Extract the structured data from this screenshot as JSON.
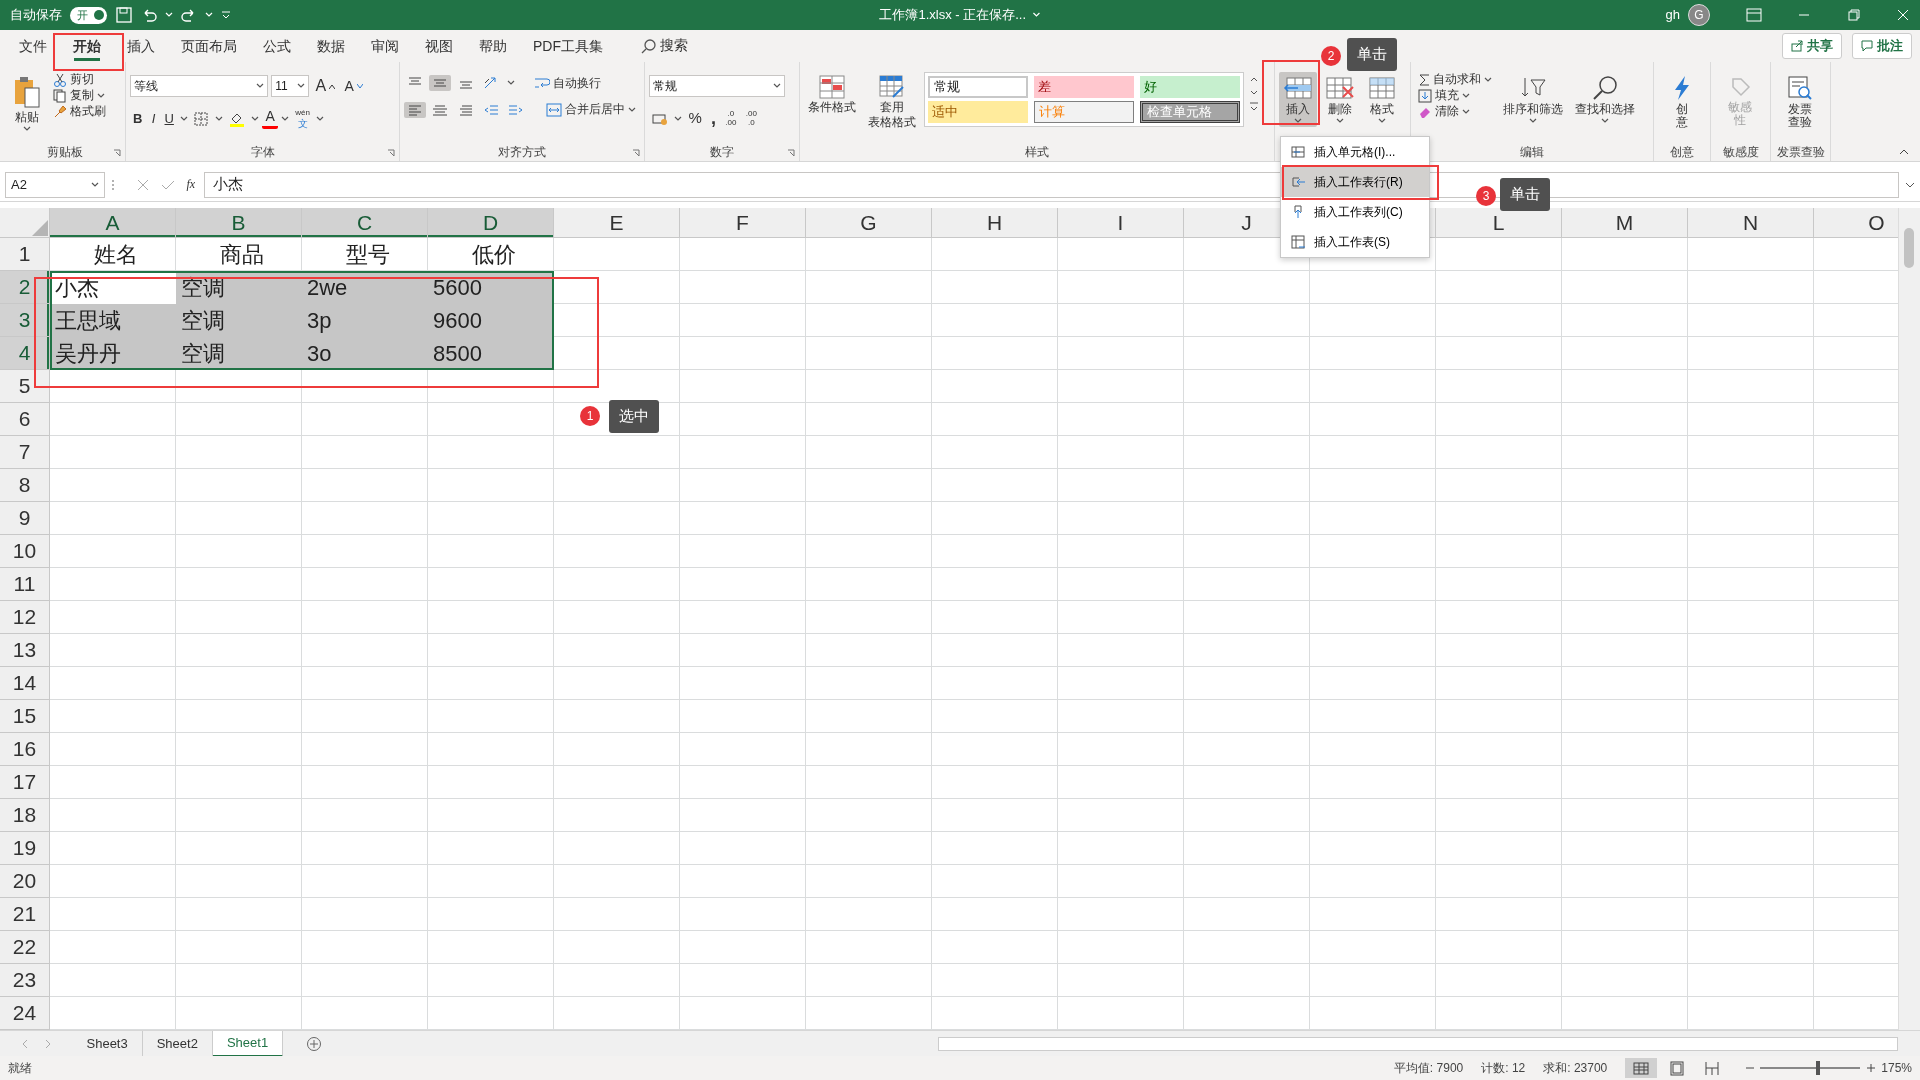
{
  "title_bar": {
    "autosave_label": "自动保存",
    "autosave_toggle": "开",
    "autosave_on": true,
    "title": "工作簿1.xlsx - 正在保存...",
    "user": "gh",
    "avatar": "G"
  },
  "ribbon_tabs": [
    {
      "label": "文件",
      "selected": false
    },
    {
      "label": "开始",
      "selected": true
    },
    {
      "label": "插入",
      "selected": false
    },
    {
      "label": "页面布局",
      "selected": false
    },
    {
      "label": "公式",
      "selected": false
    },
    {
      "label": "数据",
      "selected": false
    },
    {
      "label": "审阅",
      "selected": false
    },
    {
      "label": "视图",
      "selected": false
    },
    {
      "label": "帮助",
      "selected": false
    },
    {
      "label": "PDF工具集",
      "selected": false
    }
  ],
  "search": "搜索",
  "share": "共享",
  "comments": "批注",
  "clipboard": {
    "paste": "粘贴",
    "cut": "剪切",
    "copy": "复制",
    "format_painter": "格式刷",
    "label": "剪贴板"
  },
  "font": {
    "name": "等线",
    "size": "11",
    "grow": "A",
    "shrink": "A",
    "styles": [
      "B",
      "I",
      "U"
    ],
    "font_color": "A",
    "phonetic": [
      "wén",
      "文"
    ],
    "label": "字体"
  },
  "alignment": {
    "vertical": [
      {
        "selected": false
      },
      {
        "selected": true
      },
      {
        "selected": false
      }
    ],
    "horizontal": [
      {
        "selected": true
      },
      {
        "selected": false
      },
      {
        "selected": false
      }
    ],
    "wrap": "自动换行",
    "merge": "合并后居中",
    "label": "对齐方式"
  },
  "number": {
    "format": "常规",
    "percent": "%",
    "comma": ",",
    "decimals": [
      [
        ".0",
        ".00"
      ],
      [
        ".00",
        ".0"
      ]
    ],
    "label": "数字"
  },
  "styles": {
    "conditional": "条件格式",
    "table": [
      "套用",
      "表格格式"
    ],
    "gallery": [
      {
        "label": "常规",
        "kind": "normal"
      },
      {
        "label": "差",
        "kind": "bad"
      },
      {
        "label": "好",
        "kind": "good"
      },
      {
        "label": "适中",
        "kind": "neutral"
      },
      {
        "label": "计算",
        "kind": "calculation"
      },
      {
        "label": "检查单元格",
        "kind": "check"
      }
    ],
    "label": "样式"
  },
  "cells": [
    {
      "label": "插入",
      "pressed": true
    },
    {
      "label": "删除",
      "pressed": false
    },
    {
      "label": "格式",
      "pressed": false
    }
  ],
  "editing": {
    "autosum": "自动求和",
    "fill": "填充",
    "clear": "清除",
    "sort": "排序和筛选",
    "find": "查找和选择",
    "label": "编辑"
  },
  "creative": {
    "button": "创意",
    "label": "创意"
  },
  "sensitivity": {
    "button": "敏感性",
    "disabled": true,
    "label": "敏感度"
  },
  "invoice": {
    "button": "发票查验",
    "label": "发票查验"
  },
  "insert_menu": [
    {
      "label": "插入单元格(I)...",
      "selected": false
    },
    {
      "label": "插入工作表行(R)",
      "selected": true
    },
    {
      "label": "插入工作表列(C)",
      "selected": false
    },
    {
      "label": "插入工作表(S)",
      "selected": false
    }
  ],
  "formula_bar": {
    "name_box": "A2",
    "fx": "fx",
    "formula": "小杰"
  },
  "grid": {
    "columns": [
      {
        "label": "A",
        "selected": true
      },
      {
        "label": "B",
        "selected": true
      },
      {
        "label": "C",
        "selected": true
      },
      {
        "label": "D",
        "selected": true
      },
      {
        "label": "E",
        "selected": false
      },
      {
        "label": "F",
        "selected": false
      },
      {
        "label": "G",
        "selected": false
      },
      {
        "label": "H",
        "selected": false
      },
      {
        "label": "I",
        "selected": false
      },
      {
        "label": "J",
        "selected": false
      },
      {
        "selected": false
      },
      {
        "label": "L",
        "selected": false
      },
      {
        "label": "M",
        "selected": false
      },
      {
        "label": "N",
        "selected": false
      },
      {
        "label": "O",
        "selected": false
      }
    ],
    "rows": [
      {
        "header": "1",
        "selected": false,
        "cells": [
          {
            "text": "姓名",
            "selected": false,
            "active": false
          },
          {
            "text": "商品",
            "selected": false,
            "active": false
          },
          {
            "text": "型号",
            "selected": false,
            "active": false
          },
          {
            "text": "低价",
            "selected": false,
            "active": false
          }
        ]
      },
      {
        "header": "2",
        "selected": true,
        "cells": [
          {
            "text": "小杰",
            "selected": true,
            "active": true
          },
          {
            "text": "空调",
            "selected": true,
            "active": false
          },
          {
            "text": "2we",
            "selected": true,
            "active": false
          },
          {
            "text": "5600",
            "selected": true,
            "active": false
          }
        ]
      },
      {
        "header": "3",
        "selected": true,
        "cells": [
          {
            "text": "王思域",
            "selected": true,
            "active": false
          },
          {
            "text": "空调",
            "selected": true,
            "active": false
          },
          {
            "text": "3p",
            "selected": true,
            "active": false
          },
          {
            "text": "9600",
            "selected": true,
            "active": false
          }
        ]
      },
      {
        "header": "4",
        "selected": true,
        "cells": [
          {
            "text": "吴丹丹",
            "selected": true,
            "active": false
          },
          {
            "text": "空调",
            "selected": true,
            "active": false
          },
          {
            "text": "3o",
            "selected": true,
            "active": false
          },
          {
            "text": "8500",
            "selected": true,
            "active": false
          }
        ]
      },
      {
        "header": "5",
        "selected": false
      },
      {
        "header": "6",
        "selected": false
      },
      {
        "header": "7",
        "selected": false
      },
      {
        "header": "8",
        "selected": false
      },
      {
        "header": "9",
        "selected": false
      },
      {
        "header": "10",
        "selected": false
      },
      {
        "header": "11",
        "selected": false
      },
      {
        "header": "12",
        "selected": false
      },
      {
        "header": "13",
        "selected": false
      },
      {
        "header": "14",
        "selected": false
      },
      {
        "header": "15",
        "selected": false
      },
      {
        "header": "16",
        "selected": false
      },
      {
        "header": "17",
        "selected": false
      },
      {
        "header": "18",
        "selected": false
      },
      {
        "header": "19",
        "selected": false
      },
      {
        "header": "20",
        "selected": false
      },
      {
        "header": "21",
        "selected": false
      },
      {
        "header": "22",
        "selected": false
      },
      {
        "header": "23",
        "selected": false
      },
      {
        "header": "24",
        "selected": false
      }
    ]
  },
  "callouts": [
    {
      "number": "1",
      "text": "选中"
    },
    {
      "number": "2",
      "text": "单击"
    },
    {
      "number": "3",
      "text": "单击"
    }
  ],
  "sheet_tabs": [
    {
      "label": "Sheet3",
      "selected": false
    },
    {
      "label": "Sheet2",
      "selected": false
    },
    {
      "label": "Sheet1",
      "selected": true
    }
  ],
  "status_bar": {
    "status": "就绪",
    "stats": [
      "平均值: 7900",
      "计数: 12",
      "求和: 23700"
    ],
    "views": [
      {
        "selected": true
      },
      {
        "selected": false
      },
      {
        "selected": false
      }
    ],
    "zoom": {
      "level": 0.58
    },
    "zoom_text": "175%"
  }
}
